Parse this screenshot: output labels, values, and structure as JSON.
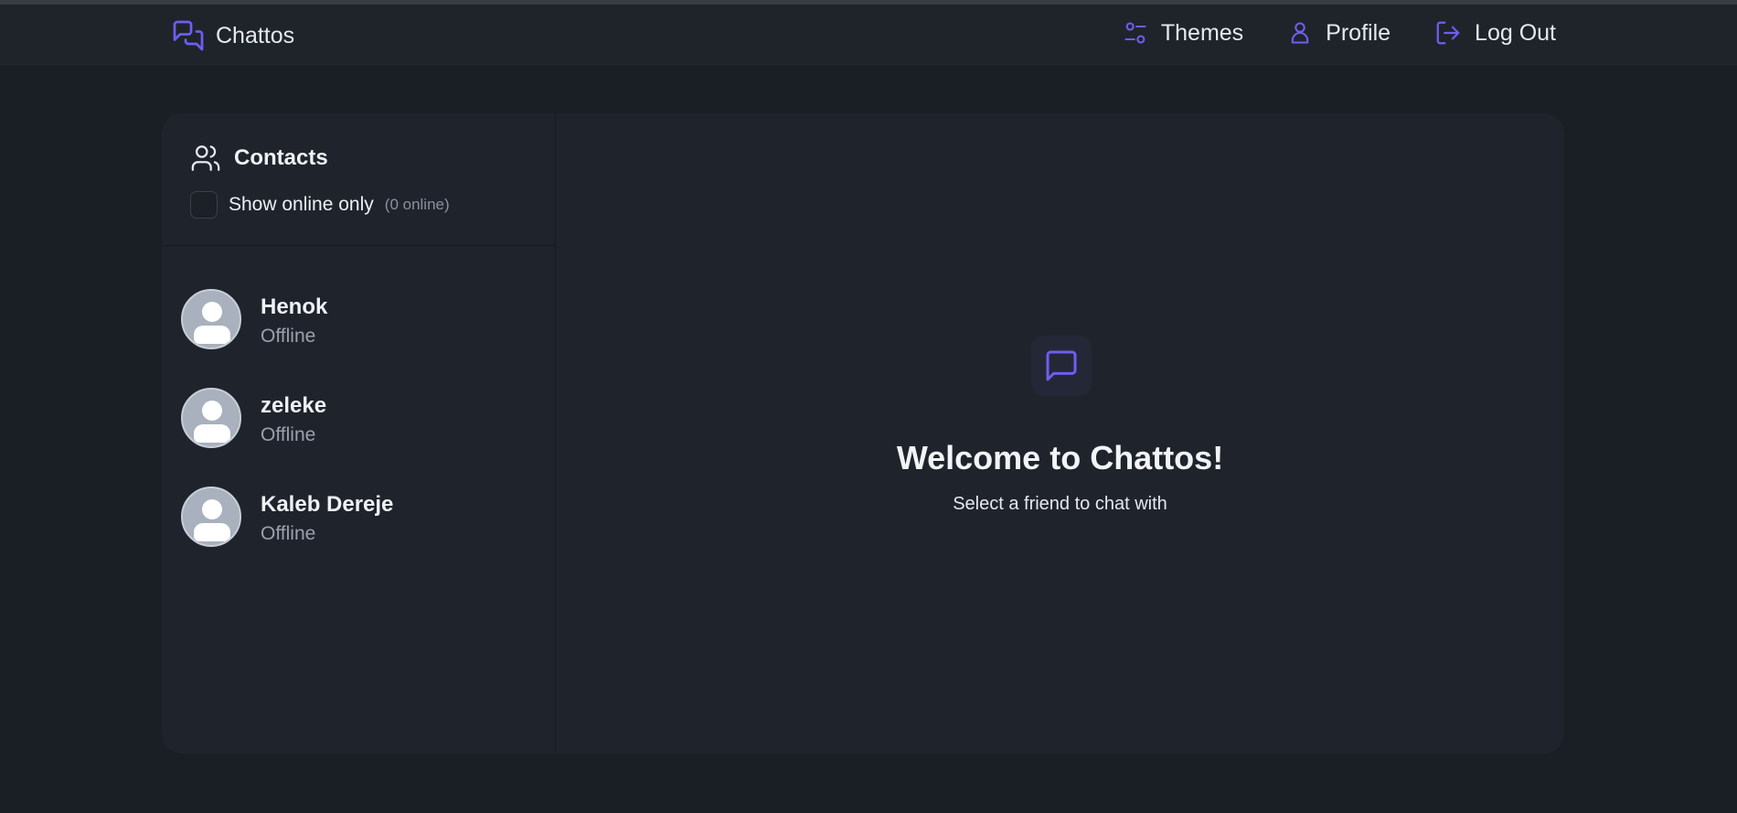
{
  "navbar": {
    "brand": "Chattos",
    "links": [
      {
        "label": "Themes",
        "icon": "sliders-icon"
      },
      {
        "label": "Profile",
        "icon": "user-icon"
      },
      {
        "label": "Log Out",
        "icon": "logout-icon"
      }
    ]
  },
  "sidebar": {
    "title": "Contacts",
    "filter_label": "Show online only",
    "online_count": "(0 online)",
    "contacts": [
      {
        "name": "Henok",
        "status": "Offline"
      },
      {
        "name": "zeleke",
        "status": "Offline"
      },
      {
        "name": "Kaleb Dereje",
        "status": "Offline"
      }
    ]
  },
  "welcome": {
    "title": "Welcome to Chattos!",
    "subtitle": "Select a friend to chat with"
  },
  "colors": {
    "accent": "#6d5ef2",
    "background": "#1a1e25",
    "card": "#1f242c",
    "navbar": "#1f242b"
  }
}
